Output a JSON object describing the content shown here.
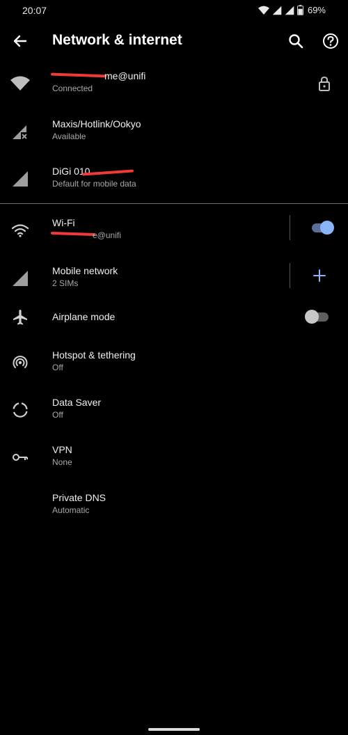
{
  "status": {
    "time": "20:07",
    "battery": "69%"
  },
  "appbar": {
    "title": "Network & internet"
  },
  "networks": [
    {
      "name": "me@unifi",
      "status": "Connected"
    },
    {
      "name": "Maxis/Hotlink/Ookyo",
      "status": "Available"
    },
    {
      "name": "DiGi 010",
      "status": "Default for mobile data"
    }
  ],
  "settings": {
    "wifi": {
      "label": "Wi-Fi",
      "sub": "e@unifi",
      "on": true
    },
    "mobile": {
      "label": "Mobile network",
      "sub": "2 SIMs"
    },
    "airplane": {
      "label": "Airplane mode",
      "on": false
    },
    "hotspot": {
      "label": "Hotspot & tethering",
      "sub": "Off"
    },
    "datasaver": {
      "label": "Data Saver",
      "sub": "Off"
    },
    "vpn": {
      "label": "VPN",
      "sub": "None"
    },
    "dns": {
      "label": "Private DNS",
      "sub": "Automatic"
    }
  },
  "colors": {
    "accent": "#8ab4f8",
    "redaction": "#f03a3a"
  }
}
